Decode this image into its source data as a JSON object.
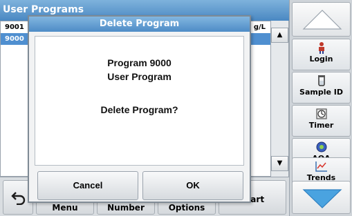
{
  "background": {
    "title": "User Programs",
    "list_header": {
      "col1": "9001",
      "col2": "g/L"
    },
    "list_selected": "9000",
    "bottom_bar": {
      "back_icon": "back-arrow-icon",
      "btn1": "Menu",
      "btn2": "Number",
      "btn3": "Options",
      "btn4": "Start"
    }
  },
  "sidebar": {
    "items": [
      {
        "label": "Login",
        "icon": "person-icon"
      },
      {
        "label": "Sample ID",
        "icon": "sample-vial-icon"
      },
      {
        "label": "Timer",
        "icon": "timer-icon"
      },
      {
        "label": "AQA",
        "icon": "aqa-icon"
      },
      {
        "label": "Trends",
        "icon": "trends-chart-icon"
      }
    ]
  },
  "dialog": {
    "title": "Delete Program",
    "line1": "Program 9000",
    "line2": "User Program",
    "question": "Delete Program?",
    "cancel_label": "Cancel",
    "ok_label": "OK"
  },
  "colors": {
    "title_blue": "#4a88c2",
    "selection_blue": "#4f8fd0",
    "nav_arrow_blue": "#4aa3e0"
  }
}
